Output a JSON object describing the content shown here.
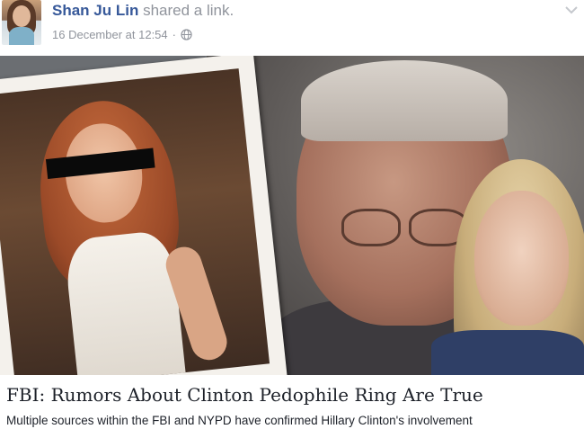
{
  "post": {
    "author": "Shan Ju Lin",
    "action": "shared a link.",
    "timestamp": "16 December at 12:54",
    "separator": "·",
    "privacy_icon": "globe-icon",
    "menu_icon": "chevron-down-icon"
  },
  "link": {
    "headline": "FBI: Rumors About Clinton Pedophile Ring Are True",
    "snippet": "Multiple sources within the FBI and NYPD have confirmed Hillary Clinton's involvement"
  },
  "colors": {
    "author_link": "#365899",
    "meta_text": "#90949c",
    "body_text": "#1d2129"
  }
}
